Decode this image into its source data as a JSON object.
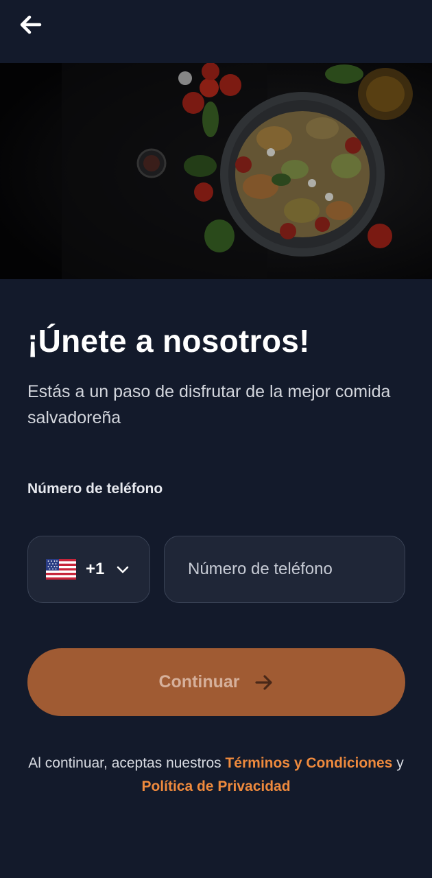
{
  "header": {
    "back_icon": "arrow-left-icon"
  },
  "hero": {
    "image": "pasta-salad-dish-photo"
  },
  "main": {
    "title": "¡Únete a nosotros!",
    "subtitle": "Estás a un paso de disfrutar de la mejor comida salvadoreña",
    "phone_label": "Número de teléfono"
  },
  "phone": {
    "country_flag": "us-flag-icon",
    "dial_code": "+1",
    "dropdown_icon": "chevron-down-icon",
    "placeholder": "Número de teléfono",
    "value": ""
  },
  "continue_button": {
    "label": "Continuar",
    "icon": "arrow-right-icon"
  },
  "terms": {
    "prefix": "Al continuar, aceptas nuestros",
    "terms_link": "Términos y Condiciones",
    "conjunction": "y",
    "privacy_link": "Política de Privacidad"
  },
  "colors": {
    "background": "#131a2b",
    "input_bg": "#1f2637",
    "accent": "#a05b33",
    "link": "#ef8a3d"
  }
}
